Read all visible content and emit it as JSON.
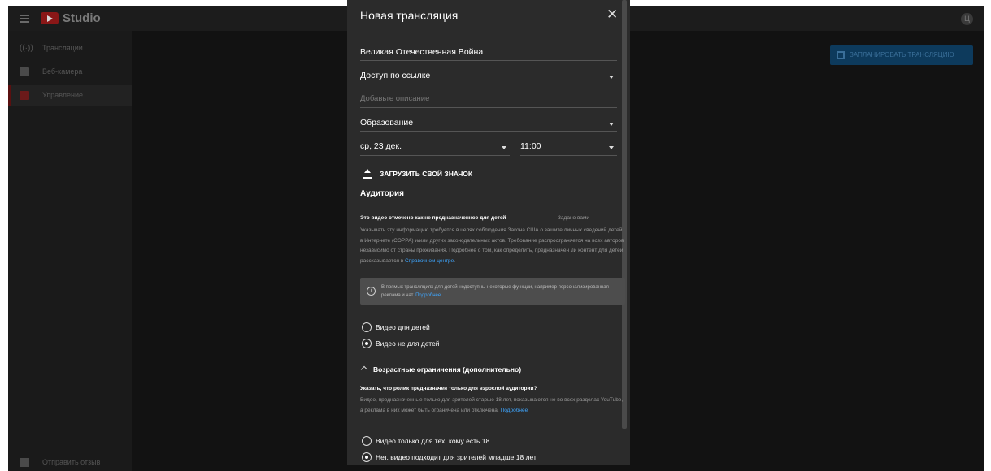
{
  "app": {
    "logo_text": "Studio",
    "avatar_letter": "Ц"
  },
  "sidebar": {
    "items": [
      {
        "label": "Трансляции",
        "icon": "broadcast-icon"
      },
      {
        "label": "Веб-камера",
        "icon": "camera-icon"
      },
      {
        "label": "Управление",
        "icon": "calendar-icon",
        "active": true
      }
    ],
    "feedback_label": "Отправить отзыв"
  },
  "main": {
    "schedule_button_label": "ЗАПЛАНИРОВАТЬ ТРАНСЛЯЦИЮ"
  },
  "dialog": {
    "title": "Новая трансляция",
    "close_symbol": "✕",
    "title_value": "Великая Отечественная Война",
    "visibility_value": "Доступ по ссылке",
    "description_placeholder": "Добавьте описание",
    "category_value": "Образование",
    "date_value": "ср, 23 дек.",
    "time_value": "11:00",
    "upload_thumbnail_label": "ЗАГРУЗИТЬ СВОЙ ЗНАЧОК",
    "audience": {
      "heading": "Аудитория",
      "status_bold": "Это видео отмечено как не предназначенное для детей",
      "status_set_by": "Задано вами",
      "paragraph": "Указывать эту информацию требуется в целях соблюдения Закона США о защите личных сведений детей в Интернете (COPPA) и/или других законодательных актов. Требование распространяется на всех авторов независимо от страны проживания. Подробнее о том, как определить, предназначен ли контент для детей, рассказывается в ",
      "paragraph_link": "Справочном центре",
      "paragraph_end": ".",
      "notice_text": "В прямых трансляциях для детей недоступны некоторые функции, например персонализированная реклама и чат. ",
      "notice_link": "Подробнее",
      "radio_for_kids": "Видео для детей",
      "radio_not_for_kids": "Видео не для детей",
      "selected": "not_for_kids"
    },
    "age": {
      "toggle_label": "Возрастные ограничения (дополнительно)",
      "question": "Указать, что ролик предназначен только для взрослой аудитории?",
      "paragraph": "Видео, предназначенные только для зрителей старше 18 лет, показываются не во всех разделах YouTube, а реклама в них может быть ограничена или отключена. ",
      "paragraph_link": "Подробнее",
      "radio_18_only": "Видео только для тех, кому есть 18",
      "radio_under_18": "Нет, видео подходит для зрителей младше 18 лет",
      "selected": "under_18"
    }
  }
}
